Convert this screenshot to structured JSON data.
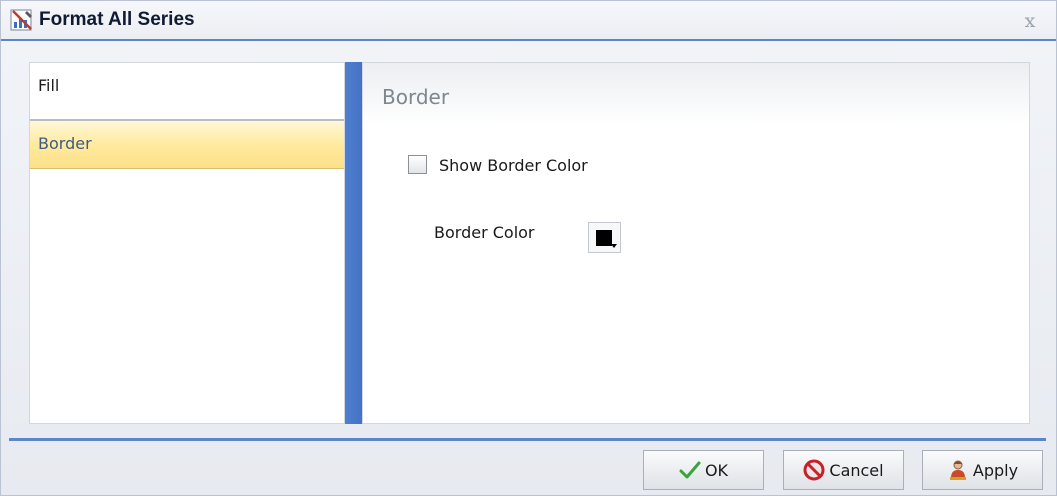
{
  "dialog": {
    "title": "Format All Series",
    "close_label": "x",
    "title_icon": "format-series-icon",
    "close_icon": "close-icon"
  },
  "nav": {
    "items": [
      {
        "label": "Fill",
        "selected": false
      },
      {
        "label": "Border",
        "selected": true
      }
    ]
  },
  "content": {
    "section_title": "Border",
    "show_border_color": {
      "label": "Show Border Color",
      "checked": false
    },
    "border_color": {
      "label": "Border Color",
      "value": "#000000"
    }
  },
  "footer": {
    "ok_label": "OK",
    "cancel_label": "Cancel",
    "apply_label": "Apply",
    "ok_icon": "checkmark-icon",
    "cancel_icon": "cancel-icon",
    "apply_icon": "apply-icon"
  },
  "colors": {
    "accent": "#4472c4",
    "title_rule": "#5b86c7",
    "selected_item": "#ffe99a",
    "section_title": "#7e8690"
  }
}
